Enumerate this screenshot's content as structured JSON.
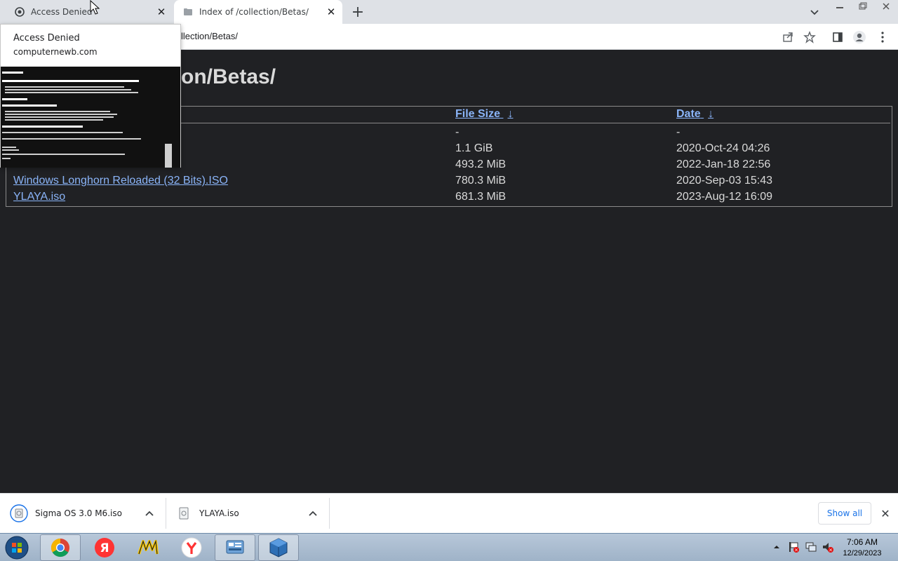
{
  "browser": {
    "tabs": [
      {
        "title": "Access Denied",
        "favicon": "cloudflare-shield-icon",
        "active": false
      },
      {
        "title": "Index of /collection/Betas/",
        "favicon": "folder-icon",
        "active": true
      }
    ],
    "address_visible": "llection/Betas/",
    "hover_card": {
      "title": "Access Denied",
      "domain": "computernewb.com"
    }
  },
  "page": {
    "title_visible": "on/Betas/",
    "columns": {
      "size": "File Size",
      "date": "Date",
      "sort_glyph": "↓"
    },
    "rows": [
      {
        "name": "",
        "size": "-",
        "date": "-"
      },
      {
        "name": "",
        "size": "1.1 GiB",
        "date": "2020-Oct-24 04:26"
      },
      {
        "name": "",
        "size": "493.2 MiB",
        "date": "2022-Jan-18 22:56"
      },
      {
        "name": "Windows Longhorn Reloaded (32 Bits).ISO",
        "size": "780.3 MiB",
        "date": "2020-Sep-03 15:43"
      },
      {
        "name": "YLAYA.iso",
        "size": "681.3 MiB",
        "date": "2023-Aug-12 16:09"
      }
    ]
  },
  "downloads": {
    "items": [
      {
        "name": "Sigma OS 3.0 M6.iso",
        "icon": "disc-image-icon"
      },
      {
        "name": "YLAYA.iso",
        "icon": "file-icon"
      }
    ],
    "show_all": "Show all"
  },
  "taskbar": {
    "time": "7:06 AM",
    "date": "12/29/2023",
    "apps": [
      "chrome",
      "yandex-browser",
      "yandex-music",
      "yandex",
      "control-panel",
      "virtualbox"
    ]
  },
  "colors": {
    "link": "#8ab4f8",
    "page_bg": "#202124",
    "accent": "#1a73e8"
  }
}
